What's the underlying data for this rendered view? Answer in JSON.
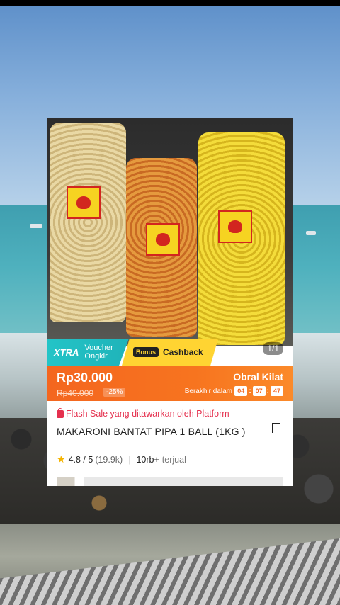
{
  "product": {
    "photo_counter": "1/1",
    "promo": {
      "xtra_brand": "XTRA",
      "xtra_voucher": "Voucher\nOngkir",
      "bonus_chip": "Bonus",
      "cashback_label": "Cashback"
    },
    "flash": {
      "price": "Rp30.000",
      "old_price": "Rp40.000",
      "discount": "-25%",
      "event_label": "Obral Kilat",
      "ends_label": "Berakhir dalam",
      "timer": [
        "04",
        "07",
        "47"
      ]
    },
    "flash_note": "Flash Sale yang ditawarkan oleh Platform",
    "title": "MAKARONI BANTAT PIPA 1 BALL (1KG )",
    "rating": "4.8 / 5",
    "rating_count": "(19.9k)",
    "sold_count": "10rb+",
    "sold_label": "terjual"
  },
  "colors": {
    "accent_orange": "#f4661f",
    "xtra_teal": "#23c4c7",
    "cashback_yellow": "#ffd432",
    "flash_red": "#e5304e",
    "star": "#f5b400"
  },
  "icons": [
    "shopping-bag-icon",
    "bookmark-icon",
    "star-icon"
  ]
}
